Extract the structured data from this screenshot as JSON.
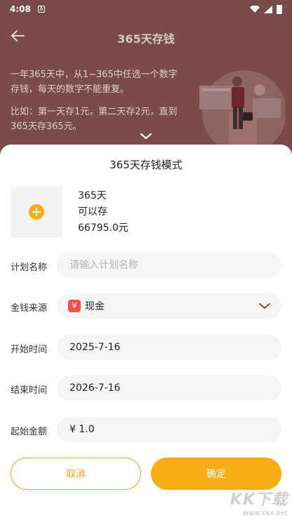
{
  "status_bar": {
    "time": "4:08",
    "notification_glyph": "A"
  },
  "header": {
    "title": "365天存钱",
    "back_icon": "arrow-left-icon"
  },
  "intro": {
    "paragraph1": "一年365天中，从1~365中任选一个数字存钱，每天的数字不能重复。",
    "paragraph2": "比如：第一天存1元，第二天存2元，直到365天存365元。"
  },
  "sheet": {
    "title": "365天存钱模式",
    "summary": {
      "days": "365天",
      "can_save": "可以存",
      "amount": "66795.0元"
    },
    "fields": {
      "plan_name": {
        "label": "计划名称",
        "value": "",
        "placeholder": "请输入计划名称"
      },
      "money_source": {
        "label": "金钱来源",
        "value": "现金",
        "icon_glyph": "¥"
      },
      "start_time": {
        "label": "开始时间",
        "value": "2025-7-16"
      },
      "end_time": {
        "label": "结束时间",
        "value": "2026-7-16"
      },
      "start_amount": {
        "label": "起始金额",
        "value": "¥ 1.0"
      }
    },
    "buttons": {
      "cancel": "取消",
      "confirm": "确定"
    }
  },
  "colors": {
    "accent": "#f8ad14",
    "overlay_bg": "#7a4b4b",
    "cash_icon": "#f05252"
  },
  "watermark": {
    "main": "KK下载",
    "url": "www.kkx.net"
  }
}
